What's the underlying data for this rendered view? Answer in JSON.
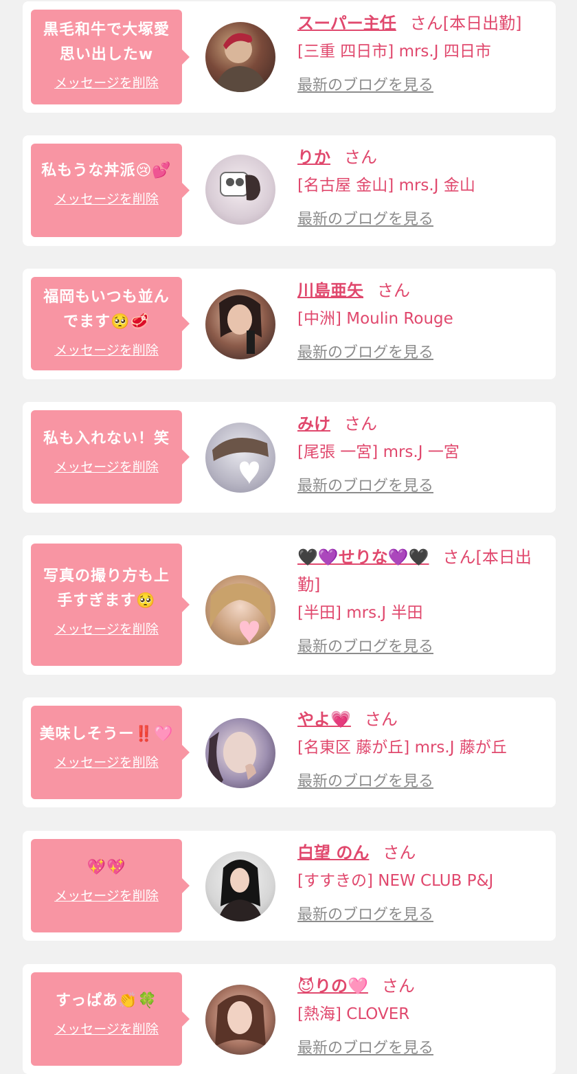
{
  "accent": "#e0486d",
  "bubble_color": "#f895a3",
  "delete_label": "メッセージを削除",
  "blog_label": "最新のブログを見る",
  "entries": [
    {
      "message": "黒毛和牛で大塚愛\n思い出したw",
      "name": "スーパー主任",
      "suffix": "さん[本日出勤]",
      "shop": "[三重 四日市] mrs.J 四日市"
    },
    {
      "message": "私もうな丼派😢💕",
      "name": "りか",
      "suffix": "さん",
      "shop": "[名古屋 金山] mrs.J 金山"
    },
    {
      "message": "福岡もいつも並ん\nでます🥺🥩",
      "name": "川島亜矢",
      "suffix": "さん",
      "shop": "[中洲] Moulin Rouge"
    },
    {
      "message": "私も入れない！笑",
      "name": "みけ",
      "suffix": "さん",
      "shop": "[尾張 一宮] mrs.J 一宮"
    },
    {
      "message": "写真の撮り方も上\n手すぎます🥺",
      "name": "🖤💜せりな💜🖤",
      "suffix": "さん[本日出勤]",
      "shop": "[半田] mrs.J 半田"
    },
    {
      "message": "美味しそうー‼️🩷",
      "name": "やよ💗",
      "suffix": "さん",
      "shop": "[名東区 藤が丘] mrs.J 藤が丘"
    },
    {
      "message": "💖💖",
      "name": "白望 のん",
      "suffix": "さん",
      "shop": "[すすきの] NEW CLUB P&J"
    },
    {
      "message": "すっぱあ👏🍀",
      "name": "😈りの🩷",
      "suffix": "さん",
      "shop": "[熱海] CLOVER"
    }
  ]
}
